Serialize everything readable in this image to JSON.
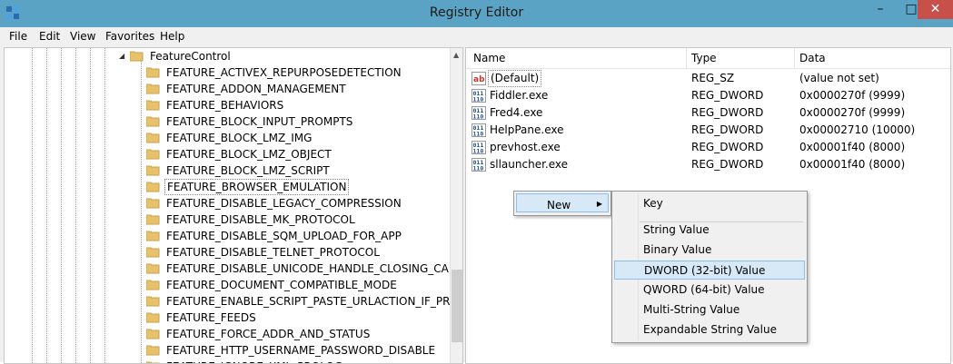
{
  "window": {
    "title": "Registry Editor",
    "min_glyph": "–",
    "max_glyph": "□",
    "close_glyph": "✕"
  },
  "menu": [
    "File",
    "Edit",
    "View",
    "Favorites",
    "Help"
  ],
  "tree": {
    "parent": "FeatureControl",
    "items": [
      "FEATURE_ACTIVEX_REPURPOSEDETECTION",
      "FEATURE_ADDON_MANAGEMENT",
      "FEATURE_BEHAVIORS",
      "FEATURE_BLOCK_INPUT_PROMPTS",
      "FEATURE_BLOCK_LMZ_IMG",
      "FEATURE_BLOCK_LMZ_OBJECT",
      "FEATURE_BLOCK_LMZ_SCRIPT",
      "FEATURE_BROWSER_EMULATION",
      "FEATURE_DISABLE_LEGACY_COMPRESSION",
      "FEATURE_DISABLE_MK_PROTOCOL",
      "FEATURE_DISABLE_SQM_UPLOAD_FOR_APP",
      "FEATURE_DISABLE_TELNET_PROTOCOL",
      "FEATURE_DISABLE_UNICODE_HANDLE_CLOSING_CALLBA",
      "FEATURE_DOCUMENT_COMPATIBLE_MODE",
      "FEATURE_ENABLE_SCRIPT_PASTE_URLACTION_IF_PROMP",
      "FEATURE_FEEDS",
      "FEATURE_FORCE_ADDR_AND_STATUS",
      "FEATURE_HTTP_USERNAME_PASSWORD_DISABLE",
      "FEATURE_IGNORE_XML_PROLOG"
    ],
    "selected": "FEATURE_BROWSER_EMULATION"
  },
  "values": {
    "columns": [
      "Name",
      "Type",
      "Data"
    ],
    "rows": [
      {
        "name": "(Default)",
        "type": "REG_SZ",
        "data": "(value not set)",
        "icon": "string-value-icon"
      },
      {
        "name": "Fiddler.exe",
        "type": "REG_DWORD",
        "data": "0x0000270f (9999)",
        "icon": "binary-value-icon"
      },
      {
        "name": "Fred4.exe",
        "type": "REG_DWORD",
        "data": "0x0000270f (9999)",
        "icon": "binary-value-icon"
      },
      {
        "name": "HelpPane.exe",
        "type": "REG_DWORD",
        "data": "0x00002710 (10000)",
        "icon": "binary-value-icon"
      },
      {
        "name": "prevhost.exe",
        "type": "REG_DWORD",
        "data": "0x00001f40 (8000)",
        "icon": "binary-value-icon"
      },
      {
        "name": "sllauncher.exe",
        "type": "REG_DWORD",
        "data": "0x00001f40 (8000)",
        "icon": "binary-value-icon"
      }
    ]
  },
  "context_menu": {
    "new_label": "New",
    "submenu": [
      "Key",
      "String Value",
      "Binary Value",
      "DWORD (32-bit) Value",
      "QWORD (64-bit) Value",
      "Multi-String Value",
      "Expandable String Value"
    ],
    "highlighted": "DWORD (32-bit) Value"
  },
  "colors": {
    "titlebar": "#5ba3c4",
    "close": "#c7504a",
    "highlight": "#d7e8f7",
    "folder": "#e8c26a"
  }
}
